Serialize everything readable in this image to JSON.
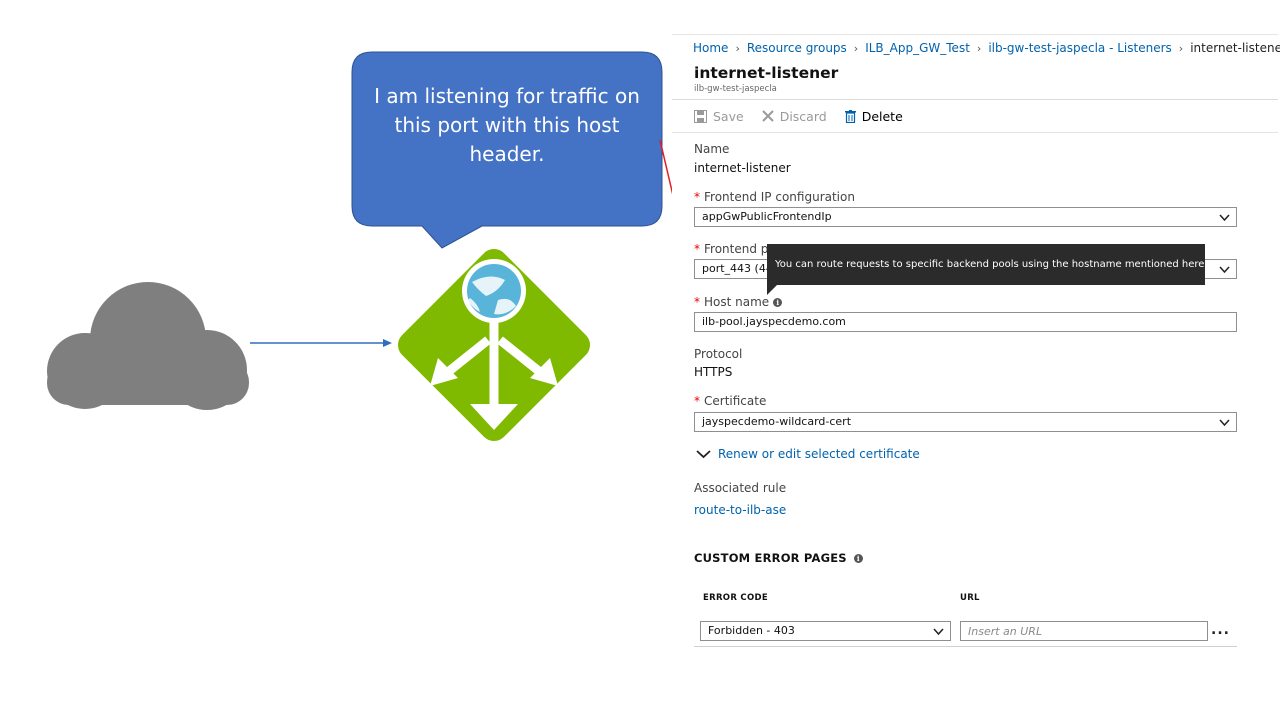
{
  "callout": {
    "text": "I am listening for traffic on this port with this host header.",
    "color": "#4472c4"
  },
  "illustration": {
    "cloud_color": "#7f7f7f",
    "gateway_color": "#7fba00",
    "globe_color": "#59b4d9",
    "arrow_color": "#2f6ebf",
    "pointer_arrow_color": "#e02020"
  },
  "breadcrumb": {
    "items": [
      "Home",
      "Resource groups",
      "ILB_App_GW_Test",
      "ilb-gw-test-jaspecla - Listeners"
    ],
    "current": "internet-listener"
  },
  "blade": {
    "title": "internet-listener",
    "subtitle": "ilb-gw-test-jaspecla"
  },
  "toolbar": {
    "save_label": "Save",
    "discard_label": "Discard",
    "delete_label": "Delete"
  },
  "form": {
    "name_label": "Name",
    "name_value": "internet-listener",
    "frontend_ip_label": "Frontend IP configuration",
    "frontend_ip_value": "appGwPublicFrontendIp",
    "frontend_port_label": "Frontend po",
    "frontend_port_value": "port_443 (443",
    "host_name_label": "Host name",
    "host_name_value": "ilb-pool.jayspecdemo.com",
    "protocol_label": "Protocol",
    "protocol_value": "HTTPS",
    "certificate_label": "Certificate",
    "certificate_value": "jayspecdemo-wildcard-cert",
    "renew_link": "Renew or edit selected certificate",
    "associated_rule_label": "Associated rule",
    "associated_rule_value": "route-to-ilb-ase"
  },
  "tooltip": {
    "text": "You can route requests to specific backend pools using the hostname mentioned here"
  },
  "custom_errors": {
    "title": "CUSTOM ERROR PAGES",
    "columns": [
      "ERROR CODE",
      "URL"
    ],
    "row": {
      "error_code": "Forbidden - 403",
      "url_placeholder": "Insert an URL"
    },
    "more": "..."
  }
}
